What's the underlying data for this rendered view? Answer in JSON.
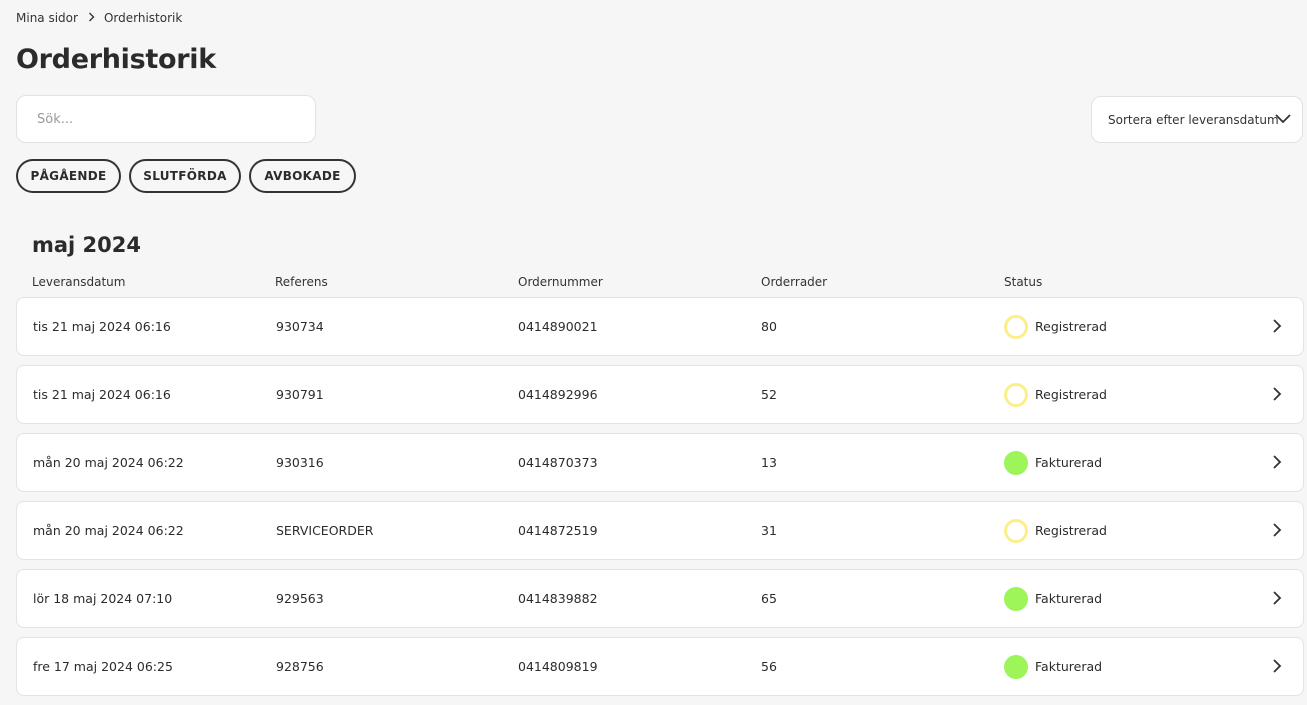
{
  "breadcrumb": {
    "home": "Mina sidor",
    "current": "Orderhistorik"
  },
  "page": {
    "title": "Orderhistorik"
  },
  "search": {
    "placeholder": "Sök...",
    "value": ""
  },
  "sort": {
    "label": "Sortera efter leveransdatum"
  },
  "filters": [
    "PÅGÅENDE",
    "SLUTFÖRDA",
    "AVBOKADE"
  ],
  "group": {
    "month": "maj 2024"
  },
  "columns": {
    "date": "Leveransdatum",
    "reference": "Referens",
    "order_number": "Ordernummer",
    "order_lines": "Orderrader",
    "status": "Status"
  },
  "status_colors": {
    "registered_ring": "#fbef8a",
    "invoiced_fill": "#9df55a"
  },
  "orders": [
    {
      "date": "tis 21 maj 2024 06:16",
      "reference": "930734",
      "order_number": "0414890021",
      "lines": "80",
      "status": "Registrerad",
      "status_type": "registered"
    },
    {
      "date": "tis 21 maj 2024 06:16",
      "reference": "930791",
      "order_number": "0414892996",
      "lines": "52",
      "status": "Registrerad",
      "status_type": "registered"
    },
    {
      "date": "mån 20 maj 2024 06:22",
      "reference": "930316",
      "order_number": "0414870373",
      "lines": "13",
      "status": "Fakturerad",
      "status_type": "invoiced"
    },
    {
      "date": "mån 20 maj 2024 06:22",
      "reference": "SERVICEORDER",
      "order_number": "0414872519",
      "lines": "31",
      "status": "Registrerad",
      "status_type": "registered"
    },
    {
      "date": "lör 18 maj 2024 07:10",
      "reference": "929563",
      "order_number": "0414839882",
      "lines": "65",
      "status": "Fakturerad",
      "status_type": "invoiced"
    },
    {
      "date": "fre 17 maj 2024 06:25",
      "reference": "928756",
      "order_number": "0414809819",
      "lines": "56",
      "status": "Fakturerad",
      "status_type": "invoiced"
    }
  ]
}
